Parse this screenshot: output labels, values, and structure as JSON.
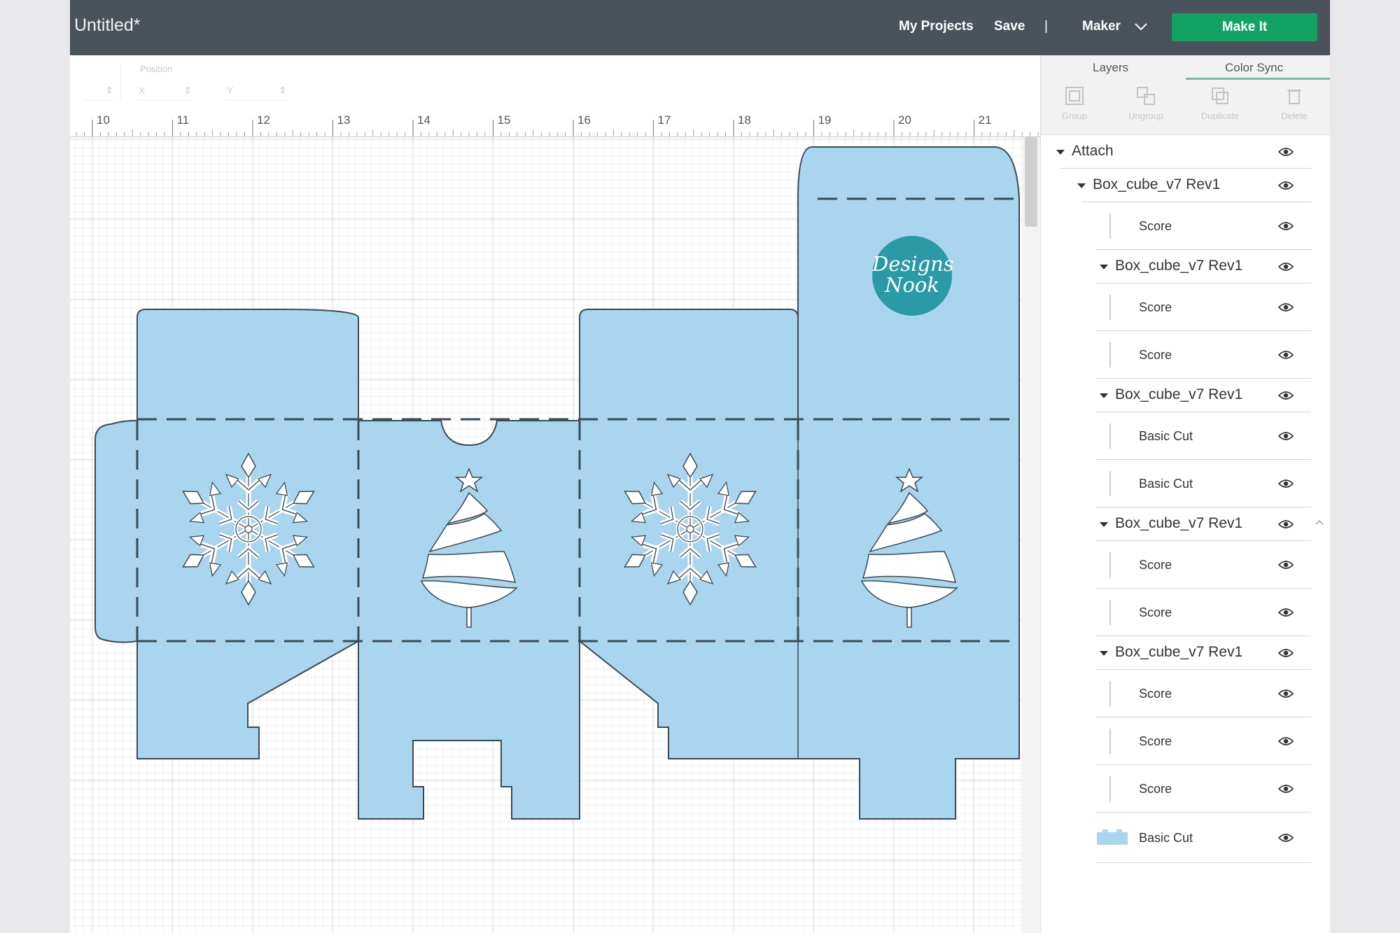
{
  "header": {
    "doc_title": "Untitled*",
    "my_projects": "My Projects",
    "save": "Save",
    "separator": "|",
    "machine": "Maker",
    "make_it": "Make It"
  },
  "edit_bar": {
    "position_label": "Position",
    "x_label": "X",
    "y_label": "Y"
  },
  "ruler": [
    "10",
    "11",
    "12",
    "13",
    "14",
    "15",
    "16",
    "17",
    "18",
    "19",
    "20",
    "21"
  ],
  "canvas": {
    "logo_line1": "Designs",
    "logo_line2": "Nook",
    "fill_color": "#a9d5ee",
    "outline_color": "#3b4a55"
  },
  "panel": {
    "tabs": [
      "Layers",
      "Color Sync"
    ],
    "tools": [
      "Group",
      "Ungroup",
      "Duplicate",
      "Delete"
    ],
    "layers": [
      {
        "label": "Attach",
        "level": 0,
        "expanded": true
      },
      {
        "label": "Box_cube_v7 Rev1",
        "level": 1,
        "expanded": true
      },
      {
        "label": "Score",
        "level": 2
      },
      {
        "label": "Box_cube_v7 Rev1",
        "level": 1,
        "expanded": true
      },
      {
        "label": "Score",
        "level": 2
      },
      {
        "label": "Score",
        "level": 2
      },
      {
        "label": "Box_cube_v7 Rev1",
        "level": 1,
        "expanded": true
      },
      {
        "label": "Basic Cut",
        "level": 2
      },
      {
        "label": "Basic Cut",
        "level": 2
      },
      {
        "label": "Box_cube_v7 Rev1",
        "level": 1,
        "expanded": true
      },
      {
        "label": "Score",
        "level": 2
      },
      {
        "label": "Score",
        "level": 2
      },
      {
        "label": "Box_cube_v7 Rev1",
        "level": 1,
        "expanded": true
      },
      {
        "label": "Score",
        "level": 2
      },
      {
        "label": "Score",
        "level": 2
      },
      {
        "label": "Score",
        "level": 2
      },
      {
        "label": "Basic Cut",
        "level": 2
      }
    ]
  }
}
